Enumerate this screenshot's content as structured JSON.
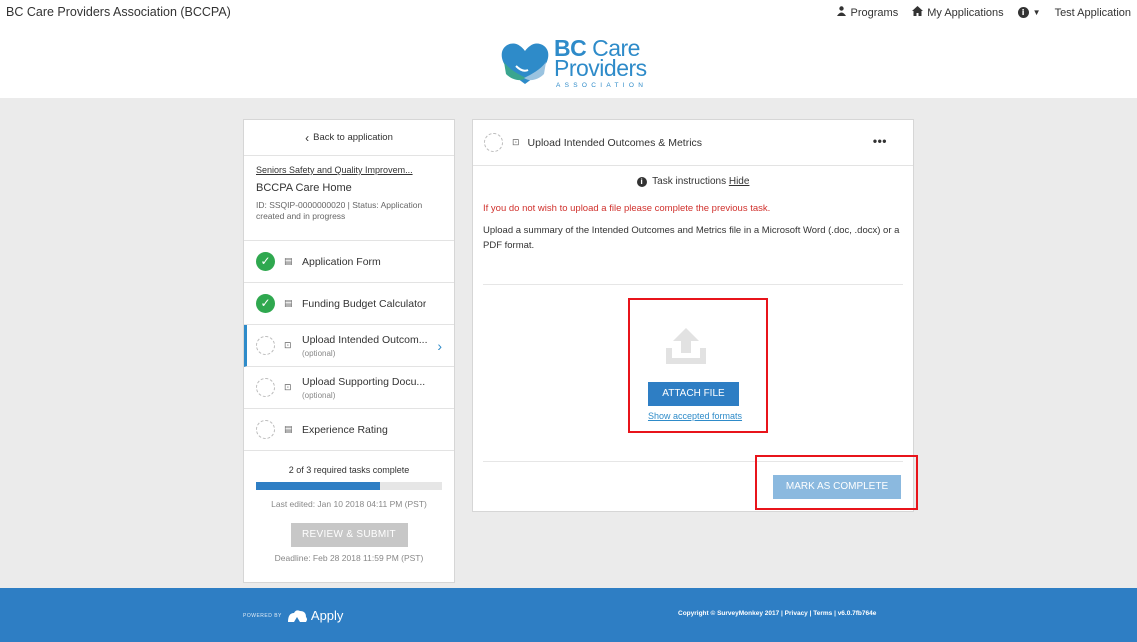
{
  "header": {
    "org_name": "BC Care Providers Association (BCCPA)",
    "nav": {
      "programs": "Programs",
      "my_applications": "My Applications",
      "info_icon": "i",
      "user": "Test Application"
    }
  },
  "logo": {
    "line1_bold": "BC",
    "line1_rest": "Care",
    "line2": "Providers",
    "line3": "ASSOCIATION",
    "colors": {
      "blue": "#2e8bc9",
      "teal": "#3aa58f",
      "heart_blue": "#2e8bc9"
    }
  },
  "sidebar": {
    "back_label": "Back to application",
    "program_name": "Seniors Safety and Quality Improvem...",
    "care_home": "BCCPA Care Home",
    "meta": "ID: SSQIP-0000000020 | Status: Application created and in progress",
    "tasks": [
      {
        "label": "Application Form",
        "sub": "",
        "status": "complete",
        "icon": "document-icon"
      },
      {
        "label": "Funding Budget Calculator",
        "sub": "",
        "status": "complete",
        "icon": "document-icon"
      },
      {
        "label": "Upload Intended Outcom...",
        "sub": "(optional)",
        "status": "pending",
        "icon": "upload-file-icon"
      },
      {
        "label": "Upload Supporting Docu...",
        "sub": "(optional)",
        "status": "pending",
        "icon": "upload-file-icon"
      },
      {
        "label": "Experience Rating",
        "sub": "",
        "status": "pending",
        "icon": "document-icon"
      }
    ],
    "progress_text": "2 of 3 required tasks complete",
    "progress_fraction": 0.667,
    "last_edited": "Last edited: Jan 10 2018 04:11 PM (PST)",
    "review_button": "REVIEW & SUBMIT",
    "deadline": "Deadline: Feb 28 2018 11:59 PM (PST)"
  },
  "task_panel": {
    "title": "Upload Intended Outcomes & Metrics",
    "more": "•••",
    "instructions_label": "Task instructions",
    "hide_label": "Hide",
    "warning": "If you do not wish to upload a file please complete the previous task.",
    "description": "Upload a summary of the Intended Outcomes and Metrics file in a Microsoft Word (.doc, .docx) or a PDF format.",
    "attach_button": "ATTACH FILE",
    "formats_link": "Show accepted formats",
    "complete_button": "MARK AS COMPLETE"
  },
  "footer": {
    "powered_by": "POWERED BY",
    "brand": "Apply",
    "copyright": "Copyright © SurveyMonkey 2017 | Privacy | Terms | v6.0.7fb764e"
  },
  "colors": {
    "accent": "#2e7ec4",
    "complete_green": "#2fa84f",
    "warning_red": "#d0312d",
    "highlight_red": "#e8141b",
    "disabled_gray": "#c7c7c7"
  }
}
